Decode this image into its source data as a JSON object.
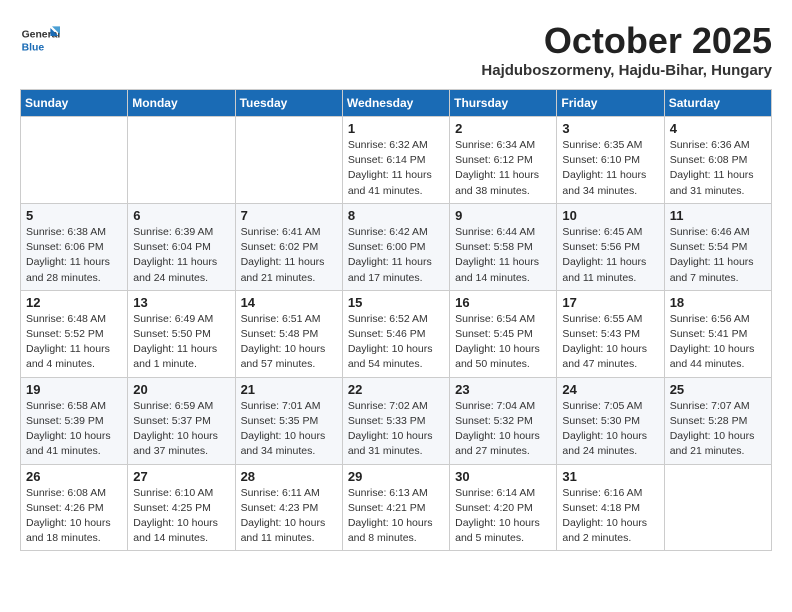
{
  "logo": {
    "general": "General",
    "blue": "Blue"
  },
  "title": "October 2025",
  "subtitle": "Hajduboszormeny, Hajdu-Bihar, Hungary",
  "days_of_week": [
    "Sunday",
    "Monday",
    "Tuesday",
    "Wednesday",
    "Thursday",
    "Friday",
    "Saturday"
  ],
  "weeks": [
    [
      {
        "day": "",
        "info": ""
      },
      {
        "day": "",
        "info": ""
      },
      {
        "day": "",
        "info": ""
      },
      {
        "day": "1",
        "info": "Sunrise: 6:32 AM\nSunset: 6:14 PM\nDaylight: 11 hours\nand 41 minutes."
      },
      {
        "day": "2",
        "info": "Sunrise: 6:34 AM\nSunset: 6:12 PM\nDaylight: 11 hours\nand 38 minutes."
      },
      {
        "day": "3",
        "info": "Sunrise: 6:35 AM\nSunset: 6:10 PM\nDaylight: 11 hours\nand 34 minutes."
      },
      {
        "day": "4",
        "info": "Sunrise: 6:36 AM\nSunset: 6:08 PM\nDaylight: 11 hours\nand 31 minutes."
      }
    ],
    [
      {
        "day": "5",
        "info": "Sunrise: 6:38 AM\nSunset: 6:06 PM\nDaylight: 11 hours\nand 28 minutes."
      },
      {
        "day": "6",
        "info": "Sunrise: 6:39 AM\nSunset: 6:04 PM\nDaylight: 11 hours\nand 24 minutes."
      },
      {
        "day": "7",
        "info": "Sunrise: 6:41 AM\nSunset: 6:02 PM\nDaylight: 11 hours\nand 21 minutes."
      },
      {
        "day": "8",
        "info": "Sunrise: 6:42 AM\nSunset: 6:00 PM\nDaylight: 11 hours\nand 17 minutes."
      },
      {
        "day": "9",
        "info": "Sunrise: 6:44 AM\nSunset: 5:58 PM\nDaylight: 11 hours\nand 14 minutes."
      },
      {
        "day": "10",
        "info": "Sunrise: 6:45 AM\nSunset: 5:56 PM\nDaylight: 11 hours\nand 11 minutes."
      },
      {
        "day": "11",
        "info": "Sunrise: 6:46 AM\nSunset: 5:54 PM\nDaylight: 11 hours\nand 7 minutes."
      }
    ],
    [
      {
        "day": "12",
        "info": "Sunrise: 6:48 AM\nSunset: 5:52 PM\nDaylight: 11 hours\nand 4 minutes."
      },
      {
        "day": "13",
        "info": "Sunrise: 6:49 AM\nSunset: 5:50 PM\nDaylight: 11 hours\nand 1 minute."
      },
      {
        "day": "14",
        "info": "Sunrise: 6:51 AM\nSunset: 5:48 PM\nDaylight: 10 hours\nand 57 minutes."
      },
      {
        "day": "15",
        "info": "Sunrise: 6:52 AM\nSunset: 5:46 PM\nDaylight: 10 hours\nand 54 minutes."
      },
      {
        "day": "16",
        "info": "Sunrise: 6:54 AM\nSunset: 5:45 PM\nDaylight: 10 hours\nand 50 minutes."
      },
      {
        "day": "17",
        "info": "Sunrise: 6:55 AM\nSunset: 5:43 PM\nDaylight: 10 hours\nand 47 minutes."
      },
      {
        "day": "18",
        "info": "Sunrise: 6:56 AM\nSunset: 5:41 PM\nDaylight: 10 hours\nand 44 minutes."
      }
    ],
    [
      {
        "day": "19",
        "info": "Sunrise: 6:58 AM\nSunset: 5:39 PM\nDaylight: 10 hours\nand 41 minutes."
      },
      {
        "day": "20",
        "info": "Sunrise: 6:59 AM\nSunset: 5:37 PM\nDaylight: 10 hours\nand 37 minutes."
      },
      {
        "day": "21",
        "info": "Sunrise: 7:01 AM\nSunset: 5:35 PM\nDaylight: 10 hours\nand 34 minutes."
      },
      {
        "day": "22",
        "info": "Sunrise: 7:02 AM\nSunset: 5:33 PM\nDaylight: 10 hours\nand 31 minutes."
      },
      {
        "day": "23",
        "info": "Sunrise: 7:04 AM\nSunset: 5:32 PM\nDaylight: 10 hours\nand 27 minutes."
      },
      {
        "day": "24",
        "info": "Sunrise: 7:05 AM\nSunset: 5:30 PM\nDaylight: 10 hours\nand 24 minutes."
      },
      {
        "day": "25",
        "info": "Sunrise: 7:07 AM\nSunset: 5:28 PM\nDaylight: 10 hours\nand 21 minutes."
      }
    ],
    [
      {
        "day": "26",
        "info": "Sunrise: 6:08 AM\nSunset: 4:26 PM\nDaylight: 10 hours\nand 18 minutes."
      },
      {
        "day": "27",
        "info": "Sunrise: 6:10 AM\nSunset: 4:25 PM\nDaylight: 10 hours\nand 14 minutes."
      },
      {
        "day": "28",
        "info": "Sunrise: 6:11 AM\nSunset: 4:23 PM\nDaylight: 10 hours\nand 11 minutes."
      },
      {
        "day": "29",
        "info": "Sunrise: 6:13 AM\nSunset: 4:21 PM\nDaylight: 10 hours\nand 8 minutes."
      },
      {
        "day": "30",
        "info": "Sunrise: 6:14 AM\nSunset: 4:20 PM\nDaylight: 10 hours\nand 5 minutes."
      },
      {
        "day": "31",
        "info": "Sunrise: 6:16 AM\nSunset: 4:18 PM\nDaylight: 10 hours\nand 2 minutes."
      },
      {
        "day": "",
        "info": ""
      }
    ]
  ]
}
